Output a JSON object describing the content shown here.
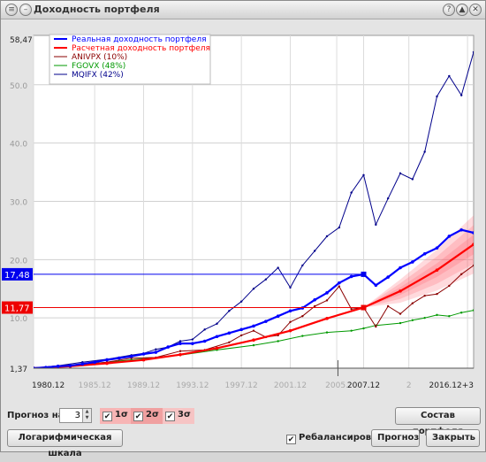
{
  "window": {
    "title": "Доходность портфеля",
    "controls": [
      "?",
      "▲",
      "✕"
    ]
  },
  "chart_data": {
    "type": "line",
    "y_axis": {
      "min": 1.37,
      "max": 58.47,
      "gridlines": [
        10,
        20,
        30,
        40,
        50
      ],
      "tick_labels": [
        "1,37",
        "10.0",
        "20.0",
        "30.0",
        "40.0",
        "50.0",
        "58,47"
      ],
      "markers": [
        {
          "label": "17,48",
          "value": 17.48,
          "color": "#0000ee"
        },
        {
          "label": "11,77",
          "value": 11.77,
          "color": "#ee0000"
        }
      ]
    },
    "x_axis": {
      "min": 1980.9,
      "max": 2016.9,
      "tick_labels": [
        {
          "x": 1980.9,
          "label": "1980.12",
          "bold": true
        },
        {
          "x": 1985.9,
          "label": "1985.12",
          "bold": false
        },
        {
          "x": 1989.9,
          "label": "1989.12",
          "bold": false
        },
        {
          "x": 1993.9,
          "label": "1993.12",
          "bold": false
        },
        {
          "x": 1997.9,
          "label": "1997.12",
          "bold": false
        },
        {
          "x": 2001.9,
          "label": "2001.12",
          "bold": false
        },
        {
          "x": 2005.7,
          "label": "2005.",
          "bold": false
        },
        {
          "x": 2007.9,
          "label": "2007.12",
          "bold": true
        },
        {
          "x": 2011.6,
          "label": "2",
          "bold": false
        },
        {
          "x": 2016.4,
          "label": "2016.12+3",
          "bold": true
        }
      ],
      "cursor": 2005.8
    },
    "legend": {
      "position": "top-left",
      "entries": [
        {
          "label": "Реальная доходность портфеля",
          "color": "#0000ff",
          "bold": true
        },
        {
          "label": "Расчетная доходность портфеля",
          "color": "#ff0000",
          "bold": true
        },
        {
          "label": "ANIVPX (10%)",
          "color": "#8b0000",
          "bold": false
        },
        {
          "label": "FGOVX (48%)",
          "color": "#009900",
          "bold": false
        },
        {
          "label": "MQIFX (42%)",
          "color": "#00008b",
          "bold": false
        }
      ]
    },
    "series": [
      {
        "name": "Реальная доходность портфеля",
        "color": "#0000ff",
        "width": 2.2,
        "markers": true,
        "points": [
          [
            1980.9,
            1.37
          ],
          [
            1981.9,
            1.5
          ],
          [
            1982.9,
            1.7
          ],
          [
            1983.9,
            1.8
          ],
          [
            1984.9,
            2.1
          ],
          [
            1985.9,
            2.4
          ],
          [
            1986.9,
            2.8
          ],
          [
            1987.9,
            3.1
          ],
          [
            1988.9,
            3.4
          ],
          [
            1989.9,
            3.8
          ],
          [
            1990.9,
            4.1
          ],
          [
            1991.9,
            5.0
          ],
          [
            1992.9,
            5.6
          ],
          [
            1993.9,
            5.6
          ],
          [
            1994.9,
            6.0
          ],
          [
            1995.9,
            6.8
          ],
          [
            1996.9,
            7.4
          ],
          [
            1997.9,
            8.0
          ],
          [
            1998.9,
            8.6
          ],
          [
            1999.9,
            9.4
          ],
          [
            2000.9,
            10.3
          ],
          [
            2001.9,
            11.2
          ],
          [
            2002.9,
            11.7
          ],
          [
            2003.9,
            13.1
          ],
          [
            2004.9,
            14.3
          ],
          [
            2005.9,
            16.0
          ],
          [
            2006.9,
            17.1
          ],
          [
            2007.9,
            17.48
          ],
          [
            2008.9,
            15.6
          ],
          [
            2009.9,
            17.0
          ],
          [
            2010.9,
            18.6
          ],
          [
            2011.9,
            19.6
          ],
          [
            2012.9,
            21.0
          ],
          [
            2013.9,
            22.0
          ],
          [
            2014.9,
            24.0
          ],
          [
            2015.9,
            25.1
          ],
          [
            2016.9,
            24.6
          ],
          [
            2017.9,
            25.3
          ]
        ]
      },
      {
        "name": "Расчетная доходность портфеля",
        "color": "#ff0000",
        "width": 2.2,
        "markers": true,
        "points": [
          [
            1980.9,
            1.37
          ],
          [
            1983.9,
            1.7
          ],
          [
            1986.9,
            2.2
          ],
          [
            1989.9,
            2.8
          ],
          [
            1992.9,
            3.7
          ],
          [
            1995.9,
            4.8
          ],
          [
            1998.9,
            6.2
          ],
          [
            2001.9,
            7.8
          ],
          [
            2004.9,
            9.9
          ],
          [
            2007.9,
            11.77
          ],
          [
            2010.9,
            14.6
          ],
          [
            2013.9,
            18.2
          ],
          [
            2016.9,
            22.6
          ],
          [
            2019.9,
            28.0
          ],
          [
            2022.9,
            34.8
          ]
        ]
      },
      {
        "name": "ANIVPX (10%)",
        "color": "#8b0000",
        "width": 1,
        "markers": true,
        "points": [
          [
            1980.9,
            1.37
          ],
          [
            1982.9,
            1.8
          ],
          [
            1984.9,
            2.0
          ],
          [
            1986.9,
            2.4
          ],
          [
            1988.9,
            3.1
          ],
          [
            1990.9,
            3.2
          ],
          [
            1992.9,
            4.3
          ],
          [
            1994.9,
            4.5
          ],
          [
            1996.9,
            5.8
          ],
          [
            1997.9,
            7.0
          ],
          [
            1998.9,
            7.8
          ],
          [
            1999.9,
            6.7
          ],
          [
            2000.9,
            7.0
          ],
          [
            2001.9,
            9.3
          ],
          [
            2002.9,
            10.3
          ],
          [
            2003.9,
            12.0
          ],
          [
            2004.9,
            13.0
          ],
          [
            2005.9,
            15.4
          ],
          [
            2006.9,
            11.5
          ],
          [
            2007.9,
            11.77
          ],
          [
            2008.9,
            8.5
          ],
          [
            2009.9,
            12.0
          ],
          [
            2010.9,
            10.7
          ],
          [
            2011.9,
            12.5
          ],
          [
            2012.9,
            13.8
          ],
          [
            2013.9,
            14.1
          ],
          [
            2014.9,
            15.5
          ],
          [
            2015.9,
            17.5
          ],
          [
            2016.9,
            19.0
          ],
          [
            2017.9,
            20.2
          ],
          [
            2018.9,
            20.5
          ]
        ]
      },
      {
        "name": "FGOVX (48%)",
        "color": "#009900",
        "width": 1,
        "markers": true,
        "points": [
          [
            1980.9,
            1.37
          ],
          [
            1984.9,
            2.0
          ],
          [
            1988.9,
            2.8
          ],
          [
            1992.9,
            3.6
          ],
          [
            1995.9,
            4.5
          ],
          [
            1998.9,
            5.3
          ],
          [
            2000.9,
            6.0
          ],
          [
            2002.9,
            6.9
          ],
          [
            2004.9,
            7.5
          ],
          [
            2006.9,
            7.8
          ],
          [
            2007.9,
            8.2
          ],
          [
            2008.9,
            8.7
          ],
          [
            2010.9,
            9.1
          ],
          [
            2011.9,
            9.6
          ],
          [
            2012.9,
            10.0
          ],
          [
            2013.9,
            10.5
          ],
          [
            2014.9,
            10.3
          ],
          [
            2015.9,
            10.9
          ],
          [
            2016.9,
            11.3
          ],
          [
            2017.9,
            11.5
          ],
          [
            2018.9,
            11.5
          ]
        ]
      },
      {
        "name": "MQIFX (42%)",
        "color": "#00008b",
        "width": 1,
        "markers": true,
        "points": [
          [
            1980.9,
            1.37
          ],
          [
            1982.9,
            1.8
          ],
          [
            1984.9,
            2.4
          ],
          [
            1986.9,
            2.9
          ],
          [
            1988.9,
            3.6
          ],
          [
            1989.9,
            3.9
          ],
          [
            1990.9,
            4.6
          ],
          [
            1991.9,
            5.0
          ],
          [
            1992.9,
            6.0
          ],
          [
            1993.9,
            6.3
          ],
          [
            1994.9,
            8.0
          ],
          [
            1995.9,
            9.0
          ],
          [
            1996.9,
            11.2
          ],
          [
            1997.9,
            12.8
          ],
          [
            1998.9,
            15.0
          ],
          [
            1999.9,
            16.6
          ],
          [
            2000.9,
            18.6
          ],
          [
            2001.9,
            15.2
          ],
          [
            2002.9,
            19.0
          ],
          [
            2003.9,
            21.5
          ],
          [
            2004.9,
            24.0
          ],
          [
            2005.9,
            25.5
          ],
          [
            2006.9,
            31.5
          ],
          [
            2007.9,
            34.5
          ],
          [
            2008.9,
            26.0
          ],
          [
            2009.9,
            30.5
          ],
          [
            2010.9,
            34.8
          ],
          [
            2011.9,
            33.8
          ],
          [
            2012.9,
            38.5
          ],
          [
            2013.9,
            48.0
          ],
          [
            2014.9,
            51.5
          ],
          [
            2015.9,
            48.2
          ],
          [
            2016.9,
            55.6
          ]
        ]
      }
    ],
    "forecast_band": {
      "color": "#ff5566",
      "center": [
        [
          2007.9,
          11.77
        ],
        [
          2010.9,
          14.6
        ],
        [
          2013.9,
          18.2
        ],
        [
          2016.9,
          22.6
        ],
        [
          2019.9,
          28.0
        ],
        [
          2022.9,
          34.8
        ]
      ],
      "halfwidth": [
        [
          2007.9,
          0.0
        ],
        [
          2010.9,
          2.0
        ],
        [
          2013.9,
          3.5
        ],
        [
          2016.9,
          5.0
        ],
        [
          2019.9,
          6.5
        ],
        [
          2022.9,
          8.0
        ]
      ]
    }
  },
  "forecast": {
    "label": "Прогноз на:",
    "years_value": "3",
    "sigma": [
      {
        "label": "1σ",
        "checked": true,
        "bg": "#f7b5b5"
      },
      {
        "label": "2σ",
        "checked": true,
        "bg": "#f0a0a0"
      },
      {
        "label": "3σ",
        "checked": true,
        "bg": "#f6c4c4"
      }
    ]
  },
  "buttons": {
    "composition": "Состав портфеля",
    "log_scale": "Логарифмическая шкала",
    "forecast": "Прогноз",
    "close": "Закрыть"
  },
  "rebalance": {
    "label": "Ребалансировки",
    "checked": true
  }
}
